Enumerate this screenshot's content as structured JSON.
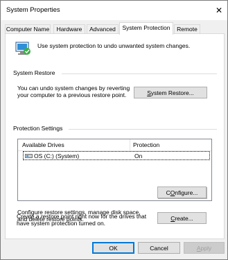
{
  "window": {
    "title": "System Properties",
    "close_glyph": "✕"
  },
  "tabs": [
    {
      "label": "Computer Name"
    },
    {
      "label": "Hardware"
    },
    {
      "label": "Advanced"
    },
    {
      "label": "System Protection",
      "active": true
    },
    {
      "label": "Remote"
    }
  ],
  "intro_text": "Use system protection to undo unwanted system changes.",
  "system_restore": {
    "heading": "System Restore",
    "description_line1": "You can undo system changes by reverting",
    "description_line2": "your computer to a previous restore point.",
    "button_mnemonic": "S",
    "button_rest": "ystem Restore..."
  },
  "protection_settings": {
    "heading": "Protection Settings",
    "columns": [
      "Available Drives",
      "Protection"
    ],
    "rows": [
      {
        "drive": "OS (C:) (System)",
        "protection": "On",
        "icon": "drive-icon"
      }
    ],
    "configure_text_line1": "Configure restore settings, manage disk space,",
    "configure_text_line2": "and delete restore points.",
    "configure_mnemonic": "O",
    "configure_prefix": "C",
    "configure_rest": "nfigure...",
    "create_text_line1": "Create a restore point right now for the drives that",
    "create_text_line2": "have system protection turned on.",
    "create_mnemonic": "C",
    "create_rest": "reate..."
  },
  "footer": {
    "ok": "OK",
    "cancel": "Cancel",
    "apply_mnemonic": "A",
    "apply_rest": "pply"
  },
  "colors": {
    "accent": "#0078d7",
    "panel": "#ffffff",
    "chrome": "#f0f0f0"
  }
}
